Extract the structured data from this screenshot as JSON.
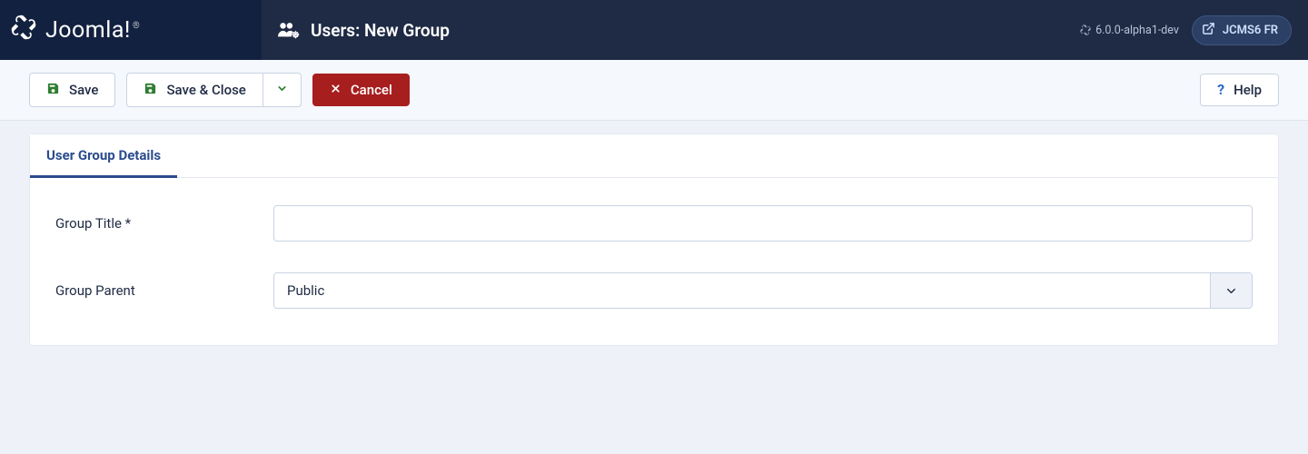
{
  "brand": {
    "name": "Joomla!"
  },
  "header": {
    "title": "Users: New Group",
    "version_label": "6.0.0-alpha1-dev",
    "site_pill_label": "JCMS6 FR"
  },
  "toolbar": {
    "save_label": "Save",
    "save_close_label": "Save & Close",
    "cancel_label": "Cancel",
    "help_label": "Help"
  },
  "tabs": {
    "active": "User Group Details"
  },
  "form": {
    "group_title_label": "Group Title *",
    "group_title_value": "",
    "group_parent_label": "Group Parent",
    "group_parent_selected": "Public"
  }
}
